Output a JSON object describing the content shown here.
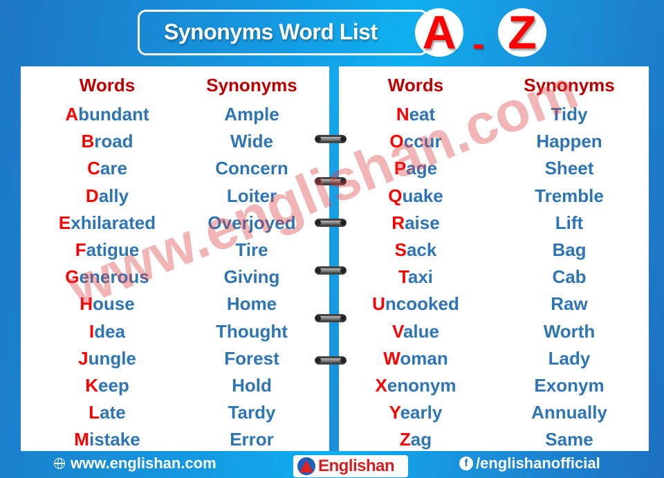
{
  "header": {
    "title": "Synonyms Word List",
    "letter_start": "A",
    "dash": "-",
    "letter_end": "Z"
  },
  "columns": {
    "words_label": "Words",
    "synonyms_label": "Synonyms"
  },
  "left_page": [
    {
      "initial": "A",
      "rest": "bundant",
      "synonym": "Ample"
    },
    {
      "initial": "B",
      "rest": "road",
      "synonym": "Wide"
    },
    {
      "initial": "C",
      "rest": "are",
      "synonym": "Concern"
    },
    {
      "initial": "D",
      "rest": "ally",
      "synonym": "Loiter"
    },
    {
      "initial": "E",
      "rest": "xhilarated",
      "synonym": "Overjoyed"
    },
    {
      "initial": "F",
      "rest": "atigue",
      "synonym": "Tire"
    },
    {
      "initial": "G",
      "rest": "enerous",
      "synonym": "Giving"
    },
    {
      "initial": "H",
      "rest": "ouse",
      "synonym": "Home"
    },
    {
      "initial": "I",
      "rest": "dea",
      "synonym": "Thought"
    },
    {
      "initial": "J",
      "rest": "ungle",
      "synonym": "Forest"
    },
    {
      "initial": "K",
      "rest": "eep",
      "synonym": "Hold"
    },
    {
      "initial": "L",
      "rest": "ate",
      "synonym": "Tardy"
    },
    {
      "initial": "M",
      "rest": "istake",
      "synonym": "Error"
    }
  ],
  "right_page": [
    {
      "initial": "N",
      "rest": "eat",
      "synonym": "Tidy"
    },
    {
      "initial": "O",
      "rest": "ccur",
      "synonym": "Happen"
    },
    {
      "initial": "P",
      "rest": "age",
      "synonym": "Sheet"
    },
    {
      "initial": "Q",
      "rest": "uake",
      "synonym": "Tremble"
    },
    {
      "initial": "R",
      "rest": "aise",
      "synonym": "Lift"
    },
    {
      "initial": "S",
      "rest": "ack",
      "synonym": "Bag"
    },
    {
      "initial": "T",
      "rest": "axi",
      "synonym": "Cab"
    },
    {
      "initial": "U",
      "rest": "ncooked",
      "synonym": "Raw"
    },
    {
      "initial": "V",
      "rest": "alue",
      "synonym": "Worth"
    },
    {
      "initial": "W",
      "rest": "oman",
      "synonym": "Lady"
    },
    {
      "initial": "X",
      "rest": "enonym",
      "synonym": "Exonym"
    },
    {
      "initial": "Y",
      "rest": "early",
      "synonym": "Annually"
    },
    {
      "initial": "Z",
      "rest": "ag",
      "synonym": "Same"
    }
  ],
  "watermark": "www.englishan.com",
  "footer": {
    "website": "www.englishan.com",
    "logo_text": "Englishan",
    "social": "/englishanofficial",
    "fb_glyph": "f"
  },
  "colors": {
    "heading_red": "#c00000",
    "initial_red": "#ff0000",
    "word_blue": "#2e75b6",
    "background_blue": "#1597e0"
  }
}
